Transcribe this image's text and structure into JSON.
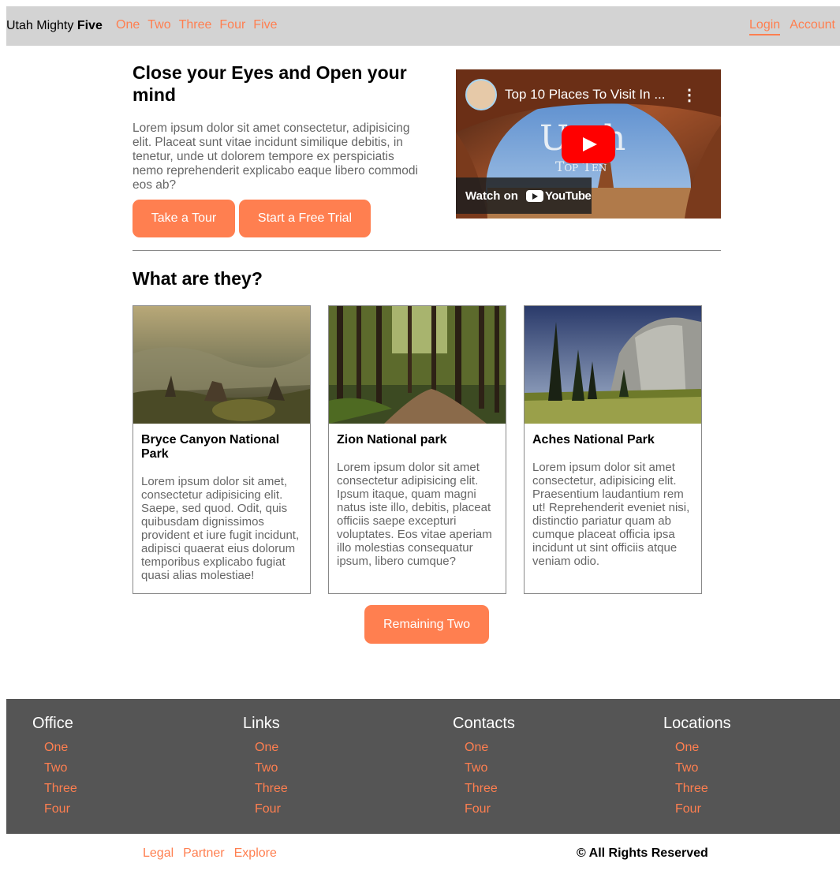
{
  "nav": {
    "brand_light": "Utah Mighty",
    "brand_bold": "Five",
    "links": [
      "One",
      "Two",
      "Three",
      "Four",
      "Five"
    ],
    "login": "Login",
    "account": "Account"
  },
  "hero": {
    "title": "Close your Eyes and Open your mind",
    "text": "Lorem ipsum dolor sit amet consectetur, adipisicing elit. Placeat sunt vitae incidunt similique debitis, in tenetur, unde ut dolorem tempore ex perspiciatis nemo reprehenderit explicabo eaque libero commodi eos ab?",
    "tour_button": "Take a Tour",
    "trial_button": "Start a Free Trial"
  },
  "video": {
    "title": "Top 10 Places To Visit In ...",
    "overlay_big": "Utah",
    "overlay_small": "Top Ten",
    "watch_on": "Watch on",
    "youtube": "YouTube"
  },
  "section": {
    "title": "What are they?"
  },
  "cards": [
    {
      "title": "Bryce Canyon National Park",
      "text": "Lorem ipsum dolor sit amet, consectetur adipisicing elit. Saepe, sed quod. Odit, quis quibusdam dignissimos provident et iure fugit incidunt, adipisci quaerat eius dolorum temporibus explicabo fugiat quasi alias molestiae!"
    },
    {
      "title": "Zion National park",
      "text": "Lorem ipsum dolor sit amet consectetur adipisicing elit. Ipsum itaque, quam magni natus iste illo, debitis, placeat officiis saepe excepturi voluptates. Eos vitae aperiam illo molestias consequatur ipsum, libero cumque?"
    },
    {
      "title": "Aches National Park",
      "text": "Lorem ipsum dolor sit amet consectetur, adipisicing elit. Praesentium laudantium rem ut! Reprehenderit eveniet nisi, distinctio pariatur quam ab cumque placeat officia ipsa incidunt ut sint officiis atque veniam odio."
    }
  ],
  "remaining_button": "Remaining Two",
  "footer": {
    "columns": [
      {
        "heading": "Office",
        "links": [
          "One",
          "Two",
          "Three",
          "Four"
        ]
      },
      {
        "heading": "Links",
        "links": [
          "One",
          "Two",
          "Three",
          "Four"
        ]
      },
      {
        "heading": "Contacts",
        "links": [
          "One",
          "Two",
          "Three",
          "Four"
        ]
      },
      {
        "heading": "Locations",
        "links": [
          "One",
          "Two",
          "Three",
          "Four"
        ]
      }
    ]
  },
  "bottom": {
    "links": [
      "Legal",
      "Partner",
      "Explore"
    ],
    "copyright": "© All Rights Reserved"
  },
  "colors": {
    "accent": "#ff7f50",
    "nav_bg": "#d3d3d3",
    "footer_bg": "#555555"
  }
}
